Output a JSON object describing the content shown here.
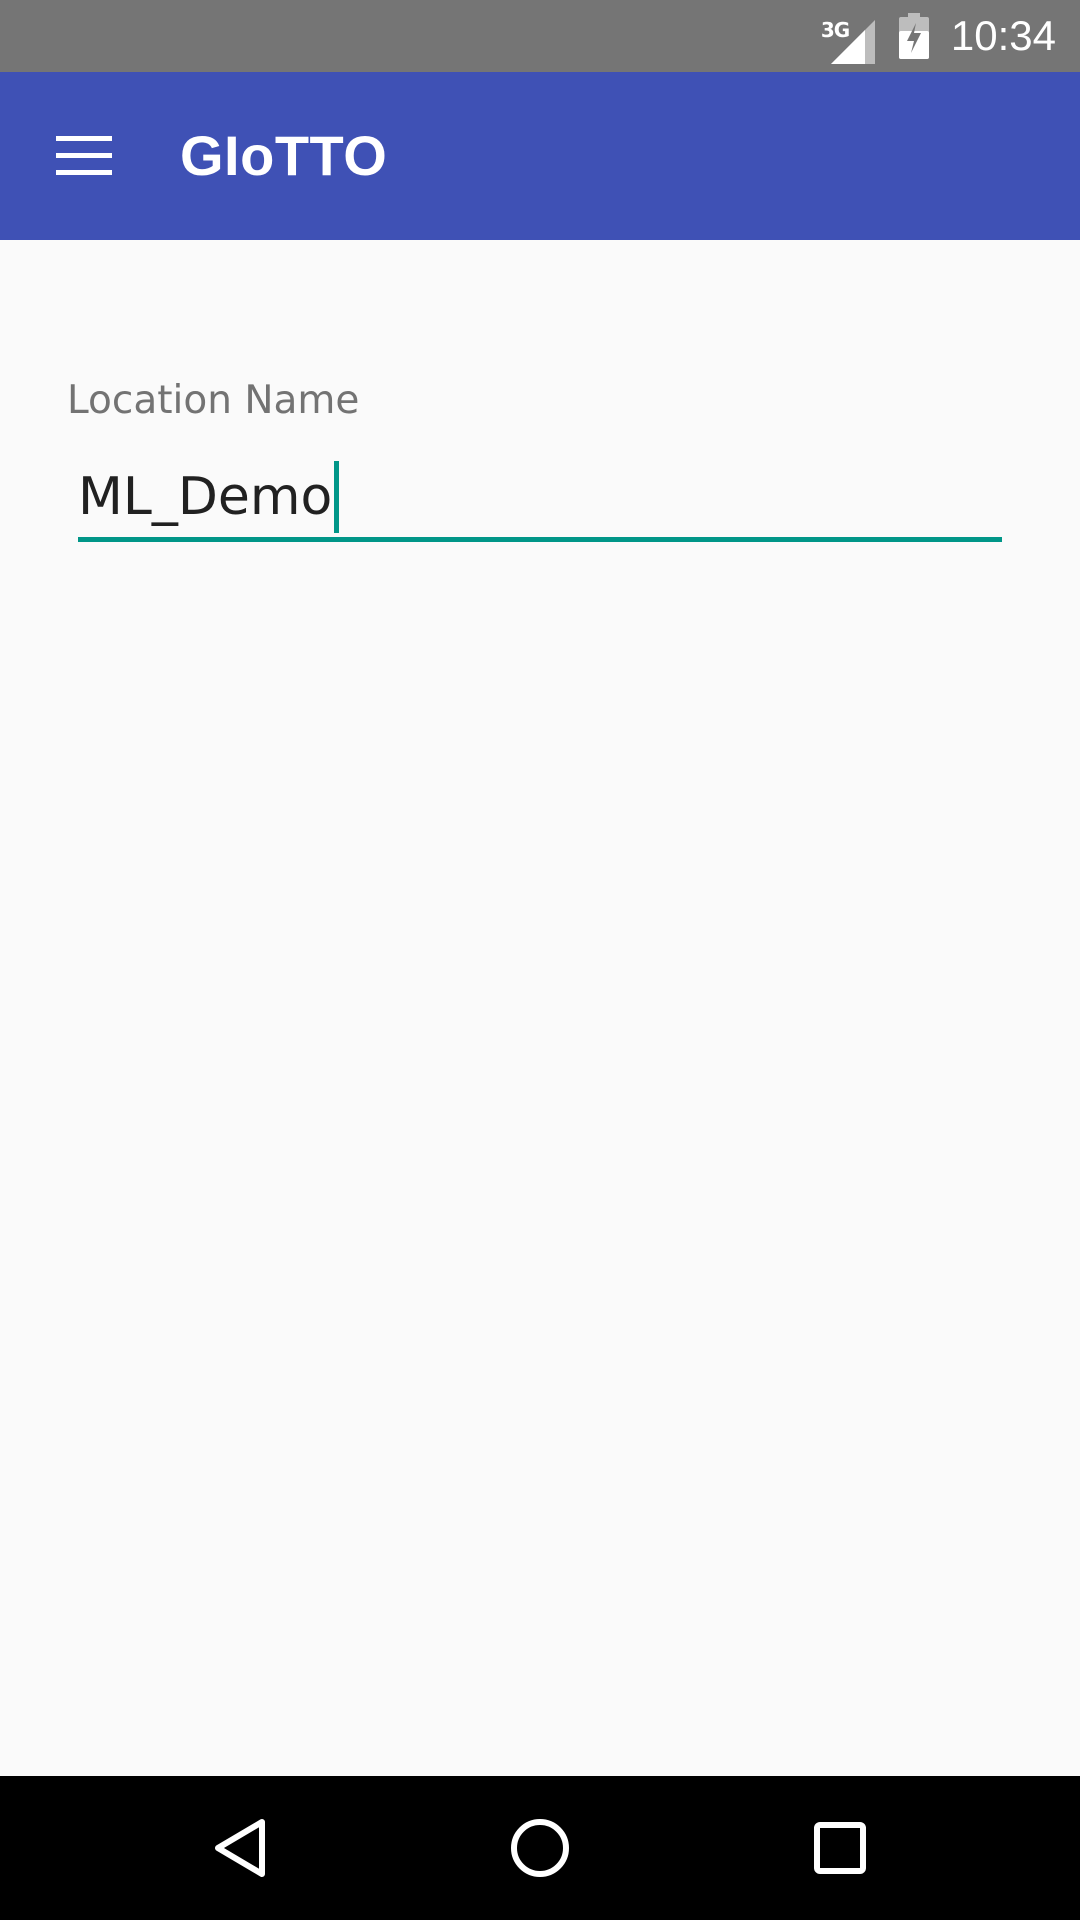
{
  "status_bar": {
    "network_type": "3G",
    "signal_icon": "cell-signal-icon",
    "battery_icon": "battery-charging-icon",
    "time": "10:34"
  },
  "app_bar": {
    "menu_icon": "hamburger-menu-icon",
    "title": "GIoTTO"
  },
  "form": {
    "location_name_label": "Location Name",
    "location_name_value": "ML_Demo"
  },
  "nav_bar": {
    "back_icon": "back-triangle-icon",
    "home_icon": "home-circle-icon",
    "recents_icon": "recents-square-icon"
  },
  "colors": {
    "status_bar": "#757575",
    "app_bar": "#3f51b5",
    "accent": "#009688",
    "background": "#fafafa",
    "nav_bar": "#000000"
  }
}
